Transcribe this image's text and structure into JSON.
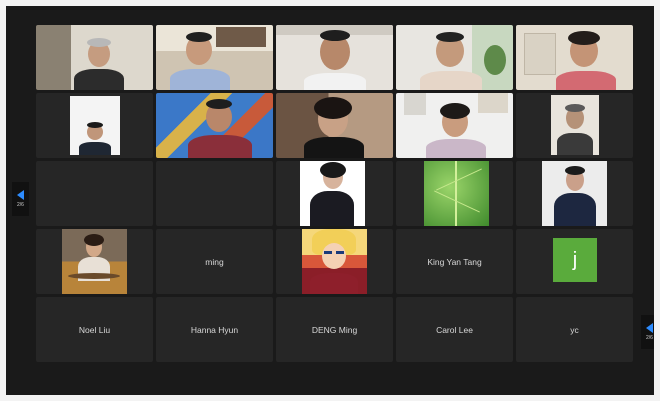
{
  "participants": [
    {
      "name": "ming"
    },
    {
      "name": "King Yan Tang"
    },
    {
      "name": "Noel Liu"
    },
    {
      "name": "Hanna Hyun"
    },
    {
      "name": "DENG Ming"
    },
    {
      "name": "Carol Lee"
    },
    {
      "name": "yc"
    }
  ],
  "avatar_initial": "j",
  "pager": {
    "left": "2/6",
    "right": "2/6"
  },
  "colors": {
    "accent": "#2d8cff",
    "tile": "#262626",
    "background": "#1a1a1a",
    "avatar_j": "#5aab3c"
  }
}
